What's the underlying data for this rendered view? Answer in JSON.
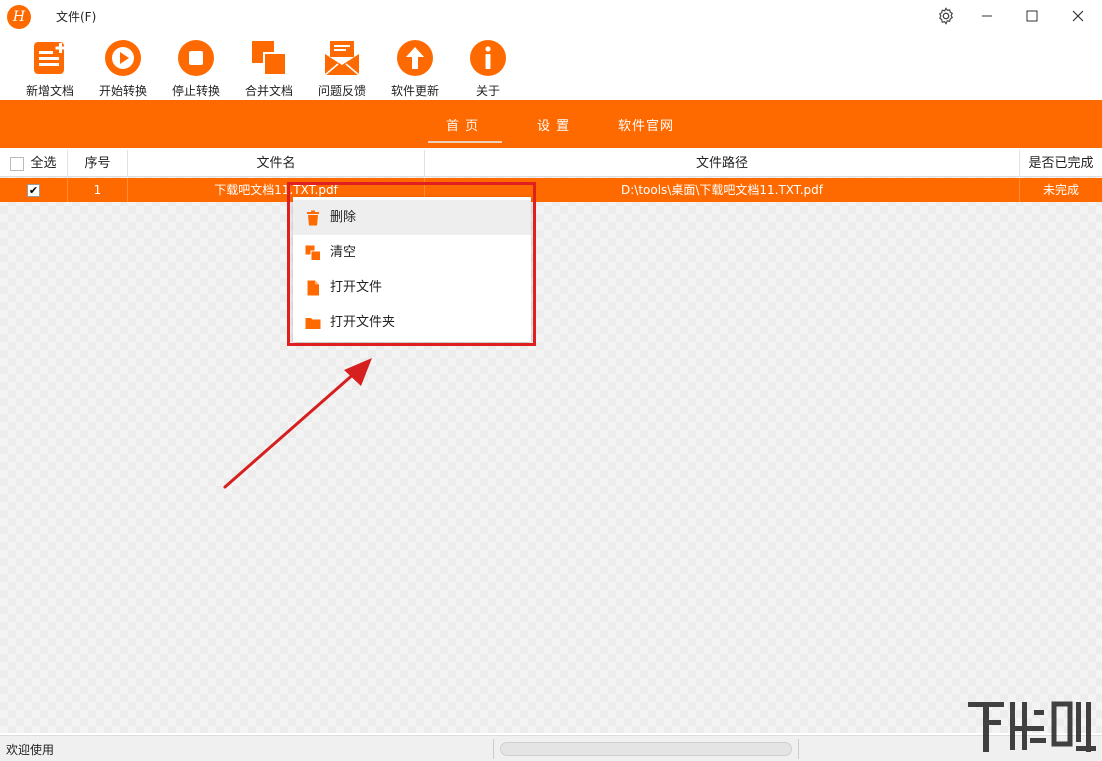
{
  "app": {
    "logo_letter": "H",
    "menu_file": "文件(F)"
  },
  "toolbar": {
    "new_doc": "新增文档",
    "start": "开始转换",
    "stop": "停止转换",
    "merge": "合并文档",
    "feedback": "问题反馈",
    "update": "软件更新",
    "about": "关于"
  },
  "nav": {
    "home": "首 页",
    "settings": "设 置",
    "website": "软件官网"
  },
  "table": {
    "headers": {
      "select_all": "全选",
      "index": "序号",
      "filename": "文件名",
      "path": "文件路径",
      "done": "是否已完成"
    },
    "rows": [
      {
        "checked": "✔",
        "index": "1",
        "filename": "下载吧文档11.TXT.pdf",
        "path": "D:\\tools\\桌面\\下载吧文档11.TXT.pdf",
        "done": "未完成"
      }
    ]
  },
  "context_menu": {
    "delete": "删除",
    "clear": "清空",
    "open_file": "打开文件",
    "open_folder": "打开文件夹"
  },
  "status": {
    "text": "欢迎使用",
    "progress": 0
  },
  "colors": {
    "accent": "#ff6a00",
    "highlight": "#e02020"
  },
  "icons": [
    "gear-icon",
    "minimize-icon",
    "maximize-icon",
    "close-icon",
    "new-doc-icon",
    "play-icon",
    "stop-icon",
    "merge-icon",
    "feedback-icon",
    "upload-icon",
    "info-icon",
    "trash-icon",
    "clear-icon",
    "file-icon",
    "folder-icon"
  ]
}
